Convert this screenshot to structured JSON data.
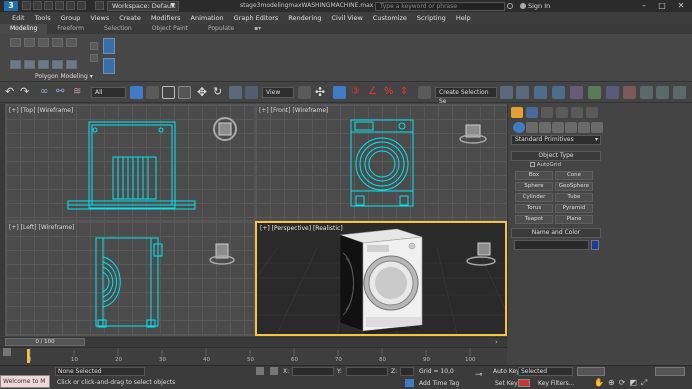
{
  "titlebar": {
    "logo": "3",
    "workspace": "Workspace: Default",
    "file_title": "stage3modelingmaxWASHINGMACHINE.max",
    "search_placeholder": "Type a keyword or phrase",
    "signin": "Sign In"
  },
  "menu": [
    "Edit",
    "Tools",
    "Group",
    "Views",
    "Create",
    "Modifiers",
    "Animation",
    "Graph Editors",
    "Rendering",
    "Civil View",
    "Customize",
    "Scripting",
    "Help"
  ],
  "ribbon": {
    "tabs": [
      "Modeling",
      "Freeform",
      "Selection",
      "Object Paint",
      "Populate"
    ],
    "panel_label": "Polygon Modeling"
  },
  "toolbar": {
    "filter_value": "All",
    "refcoord_value": "View",
    "selection_set_value": "Create Selection Se"
  },
  "viewports": {
    "top": "[+] [Top] [Wireframe]",
    "front": "[+] [Front] [Wireframe]",
    "left": "[+] [Left] [Wireframe]",
    "perspective": "[+] [Perspective] [Realistic]"
  },
  "command_panel": {
    "category": "Standard Primitives",
    "object_type_header": "Object Type",
    "autogrid_label": "AutoGrid",
    "primitives": [
      "Box",
      "Cone",
      "Sphere",
      "GeoSphere",
      "Cylinder",
      "Tube",
      "Torus",
      "Pyramid",
      "Teapot",
      "Plane"
    ],
    "name_color_header": "Name and Color"
  },
  "timeline": {
    "frame_display": "0 / 100",
    "ticks": [
      "0",
      "10",
      "20",
      "30",
      "40",
      "50",
      "60",
      "70",
      "80",
      "90",
      "100"
    ]
  },
  "status": {
    "maxscript": "Welcome to M",
    "selection": "None Selected",
    "prompt": "Click or click-and-drag to select objects",
    "x_label": "X:",
    "y_label": "Y:",
    "z_label": "Z:",
    "grid": "Grid = 10,0",
    "add_time_tag": "Add Time Tag",
    "autokey": "Auto Key",
    "autokey_value": "Selected",
    "setkey": "Set Key",
    "key_filters": "Key Filters..."
  },
  "colors": {
    "wireframe": "#00e5f0",
    "active_viewport_border": "#f5c542",
    "object_color_swatch": "#1a3aa8"
  }
}
